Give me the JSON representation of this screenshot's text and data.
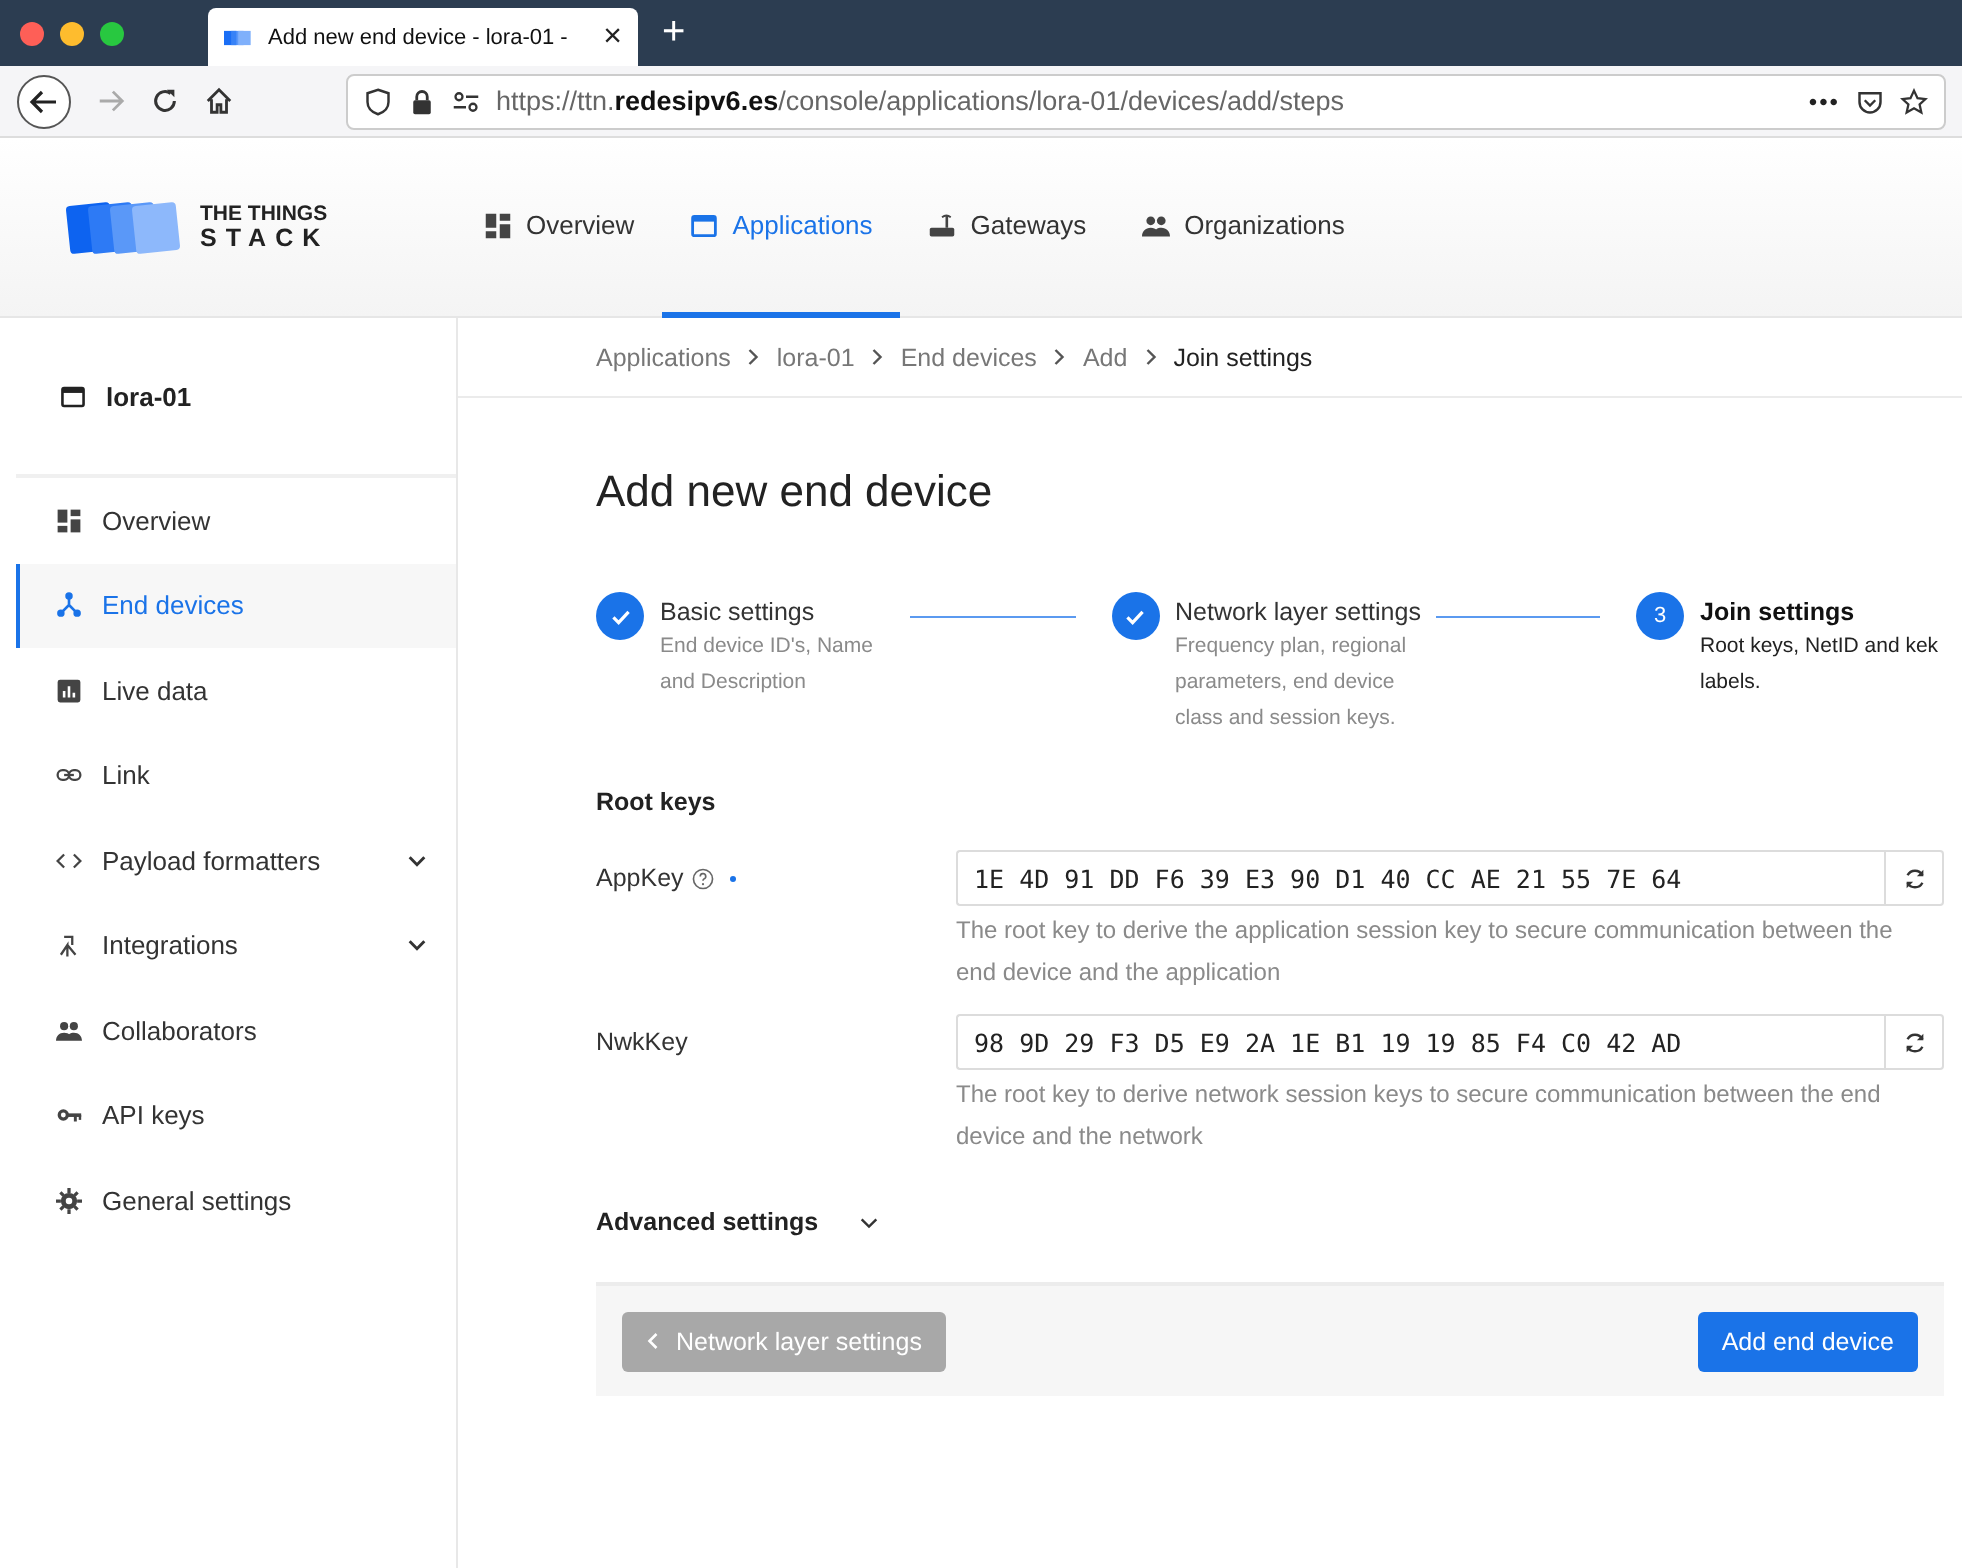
{
  "browser": {
    "tab_title": "Add new end device - lora-01 -",
    "tab_close": "×",
    "new_tab": "+",
    "url": "https://ttn.**redesipv6.es**/console/applications/lora-01/devices/add/steps",
    "more": "•••"
  },
  "header": {
    "logo_line1": "THE THINGS",
    "logo_line2": "STACK",
    "nav": [
      {
        "label": "Overview",
        "selected": false
      },
      {
        "label": "Applications",
        "selected": true
      },
      {
        "label": "Gateways",
        "selected": false
      },
      {
        "label": "Organizations",
        "selected": false
      }
    ]
  },
  "sidebar": {
    "title": "lora-01",
    "items": [
      {
        "label": "Overview",
        "selected": false,
        "expandable": false
      },
      {
        "label": "End devices",
        "selected": true,
        "expandable": false
      },
      {
        "label": "Live data",
        "selected": false,
        "expandable": false
      },
      {
        "label": "Link",
        "selected": false,
        "expandable": false
      },
      {
        "label": "Payload formatters",
        "selected": false,
        "expandable": true
      },
      {
        "label": "Integrations",
        "selected": false,
        "expandable": true
      },
      {
        "label": "Collaborators",
        "selected": false,
        "expandable": false
      },
      {
        "label": "API keys",
        "selected": false,
        "expandable": false
      },
      {
        "label": "General settings",
        "selected": false,
        "expandable": false
      }
    ]
  },
  "breadcrumb": [
    {
      "label": "Applications",
      "current": false
    },
    {
      "label": "lora-01",
      "current": false
    },
    {
      "label": "End devices",
      "current": false
    },
    {
      "label": "Add",
      "current": false
    },
    {
      "label": "Join settings",
      "current": true
    }
  ],
  "page_title": "Add new end device",
  "steps": [
    {
      "title": "Basic settings",
      "description": "End device ID's, Name and Description",
      "completed": true
    },
    {
      "title": "Network layer settings",
      "description": "Frequency plan, regional parameters, end device class and session keys.",
      "completed": true
    },
    {
      "title": "Join settings",
      "description": "Root keys, NetID and kek labels.",
      "completed": false,
      "number": "3"
    }
  ],
  "section_title": "Root keys",
  "fields": [
    {
      "label": "AppKey",
      "help": true,
      "required": true,
      "value": "1E 4D 91 DD F6 39 E3 90 D1 40 CC AE 21 55 7E 64",
      "description": "The root key to derive the application session key to secure communication between the end device and the application"
    },
    {
      "label": "NwkKey",
      "help": false,
      "required": false,
      "value": "98 9D 29 F3 D5 E9 2A 1E B1 19 19 85 F4 C0 42 AD",
      "description": "The root key to derive network session keys to secure communication between the end device and the network"
    }
  ],
  "advanced": {
    "label": "Advanced settings",
    "expanded": false
  },
  "footer": {
    "back_button": {
      "label": "Network layer settings",
      "disabled": true
    },
    "submit_button": {
      "label": "Add end device",
      "disabled": false
    }
  }
}
